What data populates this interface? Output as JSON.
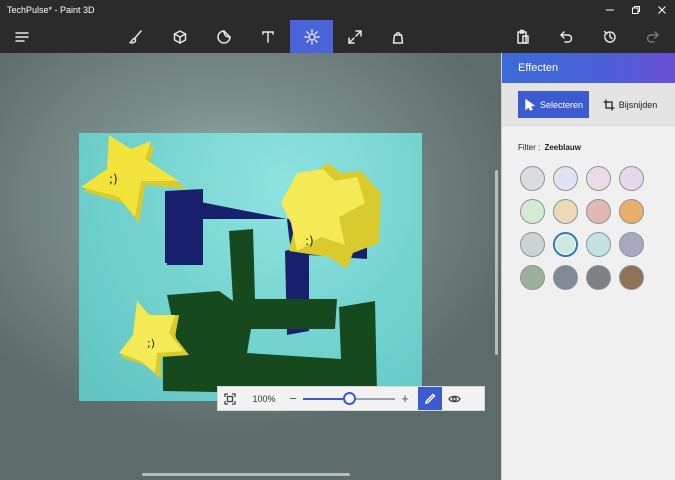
{
  "window": {
    "title": "TechPulse* - Paint 3D",
    "controls": [
      "minimize",
      "restore",
      "close"
    ]
  },
  "toolbar": {
    "left": [
      {
        "icon": "menu-icon"
      }
    ],
    "tools": [
      {
        "icon": "brush-icon",
        "label": "Kunsthulpmiddelen"
      },
      {
        "icon": "cube-icon",
        "label": "3D-vormen"
      },
      {
        "icon": "sticker-icon",
        "label": "Stickers"
      },
      {
        "icon": "text-icon",
        "label": "Tekst"
      },
      {
        "icon": "effects-sun-icon",
        "label": "Effecten",
        "active": true
      },
      {
        "icon": "canvas-resize-icon",
        "label": "Canvas"
      },
      {
        "icon": "remix-bag-icon",
        "label": "Remix 3D"
      }
    ],
    "right": [
      {
        "icon": "paste-icon"
      },
      {
        "icon": "undo-icon"
      },
      {
        "icon": "history-icon"
      },
      {
        "icon": "redo-icon",
        "disabled": true
      }
    ]
  },
  "zoom": {
    "label": "100%",
    "level": 0.5
  },
  "panel": {
    "title": "Effecten",
    "select_label": "Selecteren",
    "crop_label": "Bijsnijden",
    "filter_label": "Filter :",
    "filter_value": "Zeeblauw",
    "selected_index": 9,
    "swatches": [
      "#d9dde0",
      "#e0e3f2",
      "#ecdbe7",
      "#e4d8ea",
      "#d2ebd2",
      "#ebd9b7",
      "#e0b9b3",
      "#e8b06c",
      "#ccd3d3",
      "#cfe9e2",
      "#c4e2e1",
      "#a6a9c2",
      "#9ab09a",
      "#818b97",
      "#7d8184",
      "#8e7358"
    ]
  },
  "colors": {
    "accent": "#3c5bd0",
    "header_gradient_start": "#3b6bd8",
    "header_gradient_end": "#6a4fd4",
    "canvas_bg": "#6fd0cc",
    "navy_shape": "#18206e",
    "green_shape": "#164a1e",
    "star_yellow": "#f2e43a"
  }
}
